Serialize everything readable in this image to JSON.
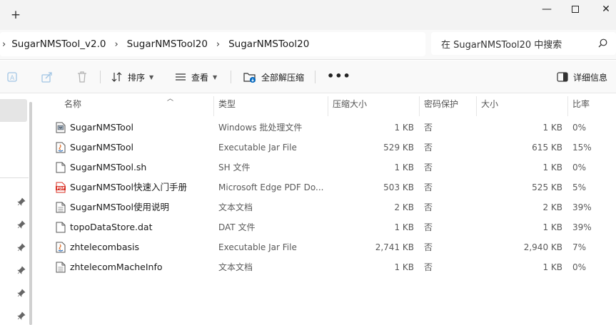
{
  "window": {
    "new_tab": "+",
    "minimize": "—",
    "close": "✕"
  },
  "address": {
    "crumbs": [
      "SugarNMSTool_v2.0",
      "SugarNMSTool20",
      "SugarNMSTool20"
    ]
  },
  "search": {
    "placeholder": "在 SugarNMSTool20 中搜索"
  },
  "toolbar": {
    "sort_label": "排序",
    "view_label": "查看",
    "extract_label": "全部解压缩",
    "more_label": "•••",
    "details_label": "详细信息"
  },
  "columns": {
    "name": "名称",
    "type": "类型",
    "compressed_size": "压缩大小",
    "password": "密码保护",
    "size": "大小",
    "ratio": "比率"
  },
  "files": [
    {
      "name": "SugarNMSTool",
      "type": "Windows 批处理文件",
      "compressed_size": "1 KB",
      "password": "否",
      "size": "1 KB",
      "ratio": "0%",
      "icon": "batch-file-icon"
    },
    {
      "name": "SugarNMSTool",
      "type": "Executable Jar File",
      "compressed_size": "529 KB",
      "password": "否",
      "size": "615 KB",
      "ratio": "15%",
      "icon": "jar-file-icon"
    },
    {
      "name": "SugarNMSTool.sh",
      "type": "SH 文件",
      "compressed_size": "1 KB",
      "password": "否",
      "size": "1 KB",
      "ratio": "0%",
      "icon": "generic-file-icon"
    },
    {
      "name": "SugarNMSTool快速入门手册",
      "type": "Microsoft Edge PDF Do...",
      "compressed_size": "503 KB",
      "password": "否",
      "size": "525 KB",
      "ratio": "5%",
      "icon": "pdf-file-icon"
    },
    {
      "name": "SugarNMSTool使用说明",
      "type": "文本文档",
      "compressed_size": "2 KB",
      "password": "否",
      "size": "2 KB",
      "ratio": "39%",
      "icon": "text-file-icon"
    },
    {
      "name": "topoDataStore.dat",
      "type": "DAT 文件",
      "compressed_size": "1 KB",
      "password": "否",
      "size": "1 KB",
      "ratio": "39%",
      "icon": "generic-file-icon"
    },
    {
      "name": "zhtelecombasis",
      "type": "Executable Jar File",
      "compressed_size": "2,741 KB",
      "password": "否",
      "size": "2,940 KB",
      "ratio": "7%",
      "icon": "jar-file-icon"
    },
    {
      "name": "zhtelecomMacheInfo",
      "type": "文本文档",
      "compressed_size": "1 KB",
      "password": "否",
      "size": "1 KB",
      "ratio": "0%",
      "icon": "text-file-icon"
    }
  ],
  "colors": {
    "accent": "#0067c0",
    "pdf_red": "#d93025",
    "selected": "#e5e5e5"
  }
}
